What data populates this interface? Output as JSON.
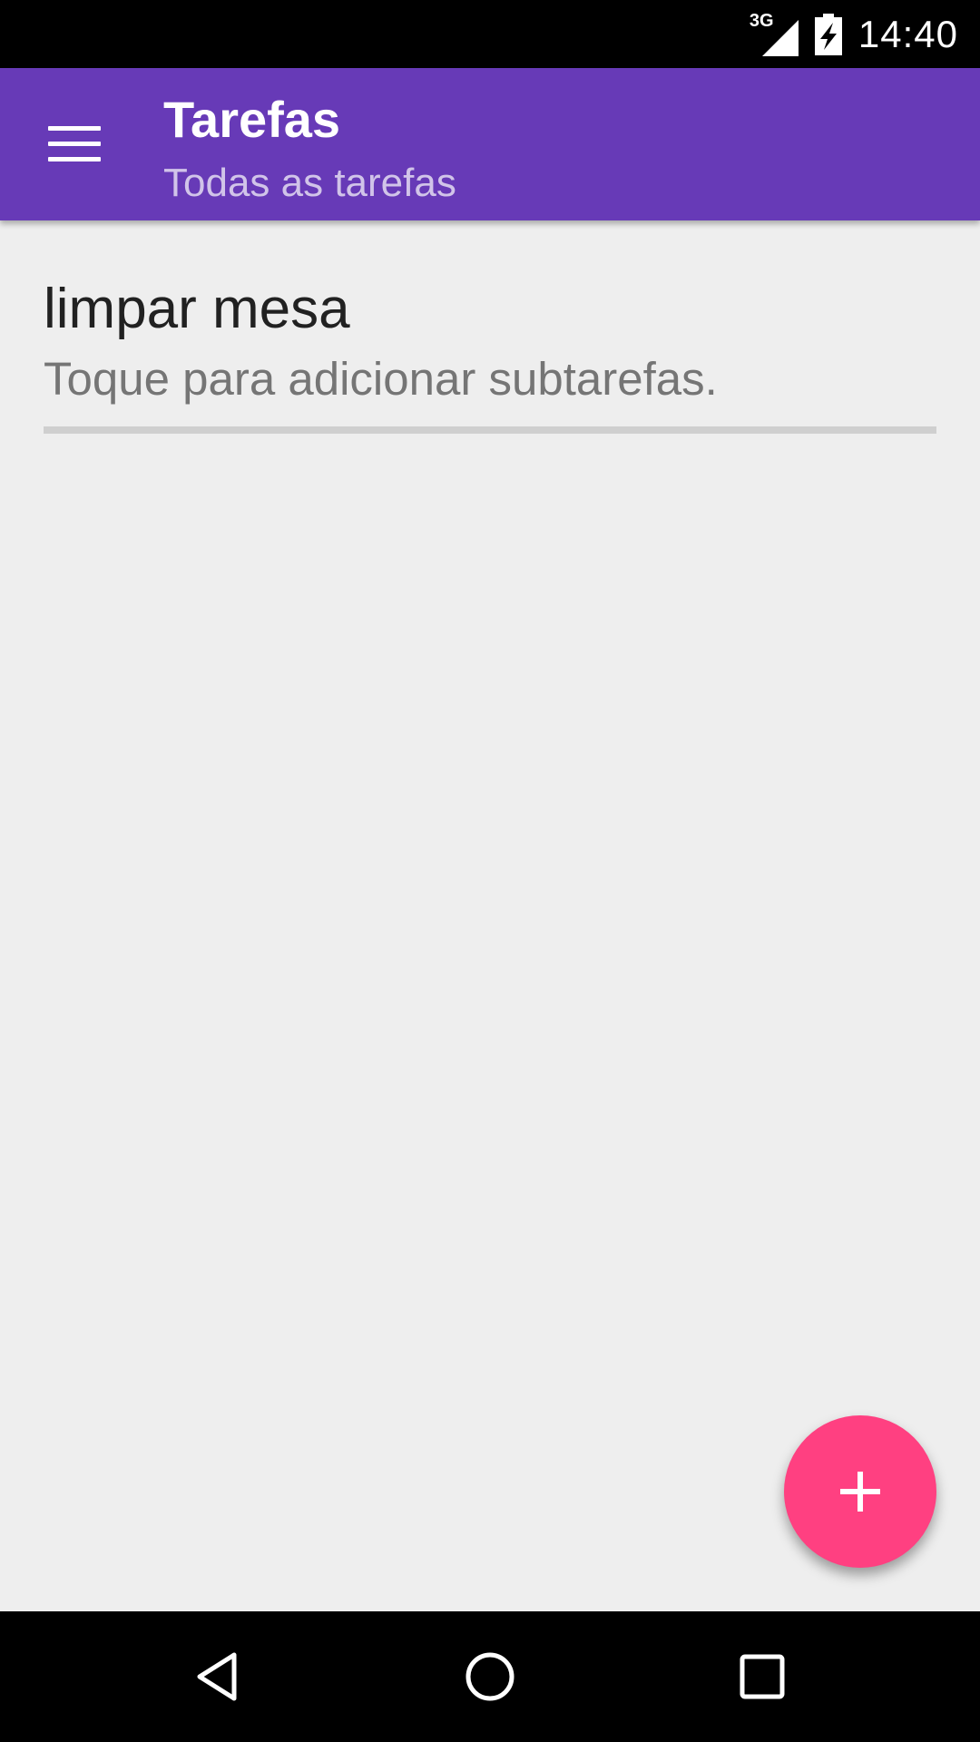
{
  "status_bar": {
    "network_label": "3G",
    "network_icon": "signal-icon",
    "battery_icon": "battery-charging-icon",
    "time": "14:40"
  },
  "app_bar": {
    "menu_icon": "menu-icon",
    "title": "Tarefas",
    "subtitle": "Todas as tarefas",
    "color": "#673ab7"
  },
  "tasks": [
    {
      "title": "limpar mesa",
      "hint": "Toque para adicionar subtarefas."
    }
  ],
  "fab": {
    "icon": "plus-icon",
    "color": "#ff4081"
  },
  "nav_bar": {
    "back_icon": "back-icon",
    "home_icon": "home-icon",
    "recents_icon": "recents-icon"
  }
}
